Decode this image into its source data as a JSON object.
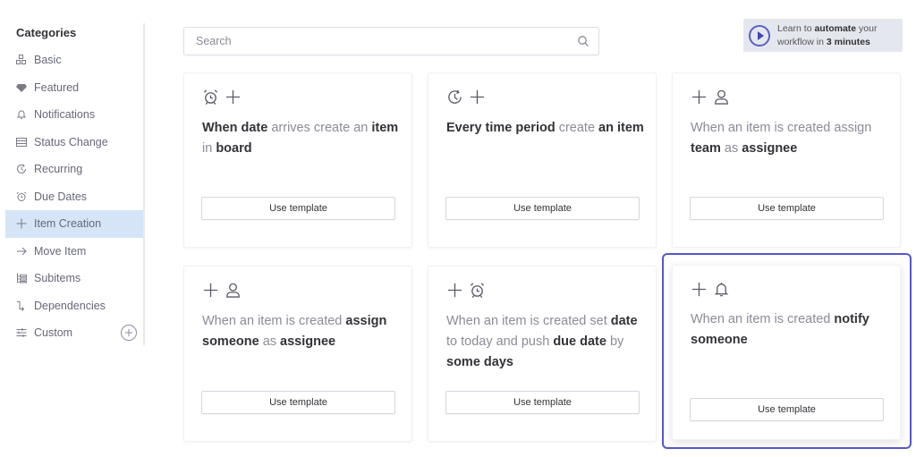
{
  "sidebar": {
    "title": "Categories",
    "items": [
      {
        "label": "Basic",
        "icon": "blocks-icon"
      },
      {
        "label": "Featured",
        "icon": "diamond-icon"
      },
      {
        "label": "Notifications",
        "icon": "bell-icon"
      },
      {
        "label": "Status Change",
        "icon": "status-list-icon"
      },
      {
        "label": "Recurring",
        "icon": "recurring-clock-icon"
      },
      {
        "label": "Due Dates",
        "icon": "alarm-clock-icon"
      },
      {
        "label": "Item Creation",
        "icon": "plus-icon",
        "active": true
      },
      {
        "label": "Move Item",
        "icon": "arrow-right-icon"
      },
      {
        "label": "Subitems",
        "icon": "subitems-icon"
      },
      {
        "label": "Dependencies",
        "icon": "dependency-icon"
      },
      {
        "label": "Custom",
        "icon": "sliders-icon"
      }
    ],
    "add_custom_icon": "plus-circle-icon"
  },
  "search": {
    "placeholder": "Search",
    "value": "",
    "icon": "search-icon"
  },
  "promo": {
    "icon": "play-icon",
    "text_1": "Learn to ",
    "text_bold_1": "automate",
    "text_2": " your workflow in ",
    "text_bold_2": "3 minutes",
    "accent": "#5557c7"
  },
  "cards": [
    {
      "icons": [
        "alarm-clock-icon",
        "plus-icon"
      ],
      "segments": [
        {
          "t": "When date",
          "b": true
        },
        {
          "t": " arrives create an ",
          "b": false
        },
        {
          "t": "item",
          "b": true
        },
        {
          "t": " in ",
          "b": false
        },
        {
          "t": "board",
          "b": true
        }
      ],
      "button": "Use template"
    },
    {
      "icons": [
        "recurring-clock-icon",
        "plus-icon"
      ],
      "segments": [
        {
          "t": "Every time period",
          "b": true
        },
        {
          "t": " create ",
          "b": false
        },
        {
          "t": "an item",
          "b": true
        }
      ],
      "button": "Use template"
    },
    {
      "icons": [
        "plus-icon",
        "person-icon"
      ],
      "segments": [
        {
          "t": "When an item is created assign ",
          "b": false
        },
        {
          "t": "team",
          "b": true
        },
        {
          "t": " as ",
          "b": false
        },
        {
          "t": "assignee",
          "b": true
        }
      ],
      "button": "Use template"
    },
    {
      "icons": [
        "plus-icon",
        "person-icon"
      ],
      "segments": [
        {
          "t": "When an item is created ",
          "b": false
        },
        {
          "t": "assign someone",
          "b": true
        },
        {
          "t": " as ",
          "b": false
        },
        {
          "t": "assignee",
          "b": true
        }
      ],
      "button": "Use template"
    },
    {
      "icons": [
        "plus-icon",
        "alarm-clock-icon"
      ],
      "segments": [
        {
          "t": "When an item is created set ",
          "b": false
        },
        {
          "t": "date",
          "b": true
        },
        {
          "t": " to today and push ",
          "b": false
        },
        {
          "t": "due date",
          "b": true
        },
        {
          "t": " by ",
          "b": false
        },
        {
          "t": "some days",
          "b": true
        }
      ],
      "button": "Use template"
    },
    {
      "icons": [
        "plus-icon",
        "bell-icon"
      ],
      "segments": [
        {
          "t": "When an item is created ",
          "b": false
        },
        {
          "t": "notify someone",
          "b": true
        }
      ],
      "button": "Use template",
      "highlighted": true
    }
  ],
  "colors": {
    "active_category_bg": "#d6e4f7",
    "highlight_border": "#5557c7"
  }
}
